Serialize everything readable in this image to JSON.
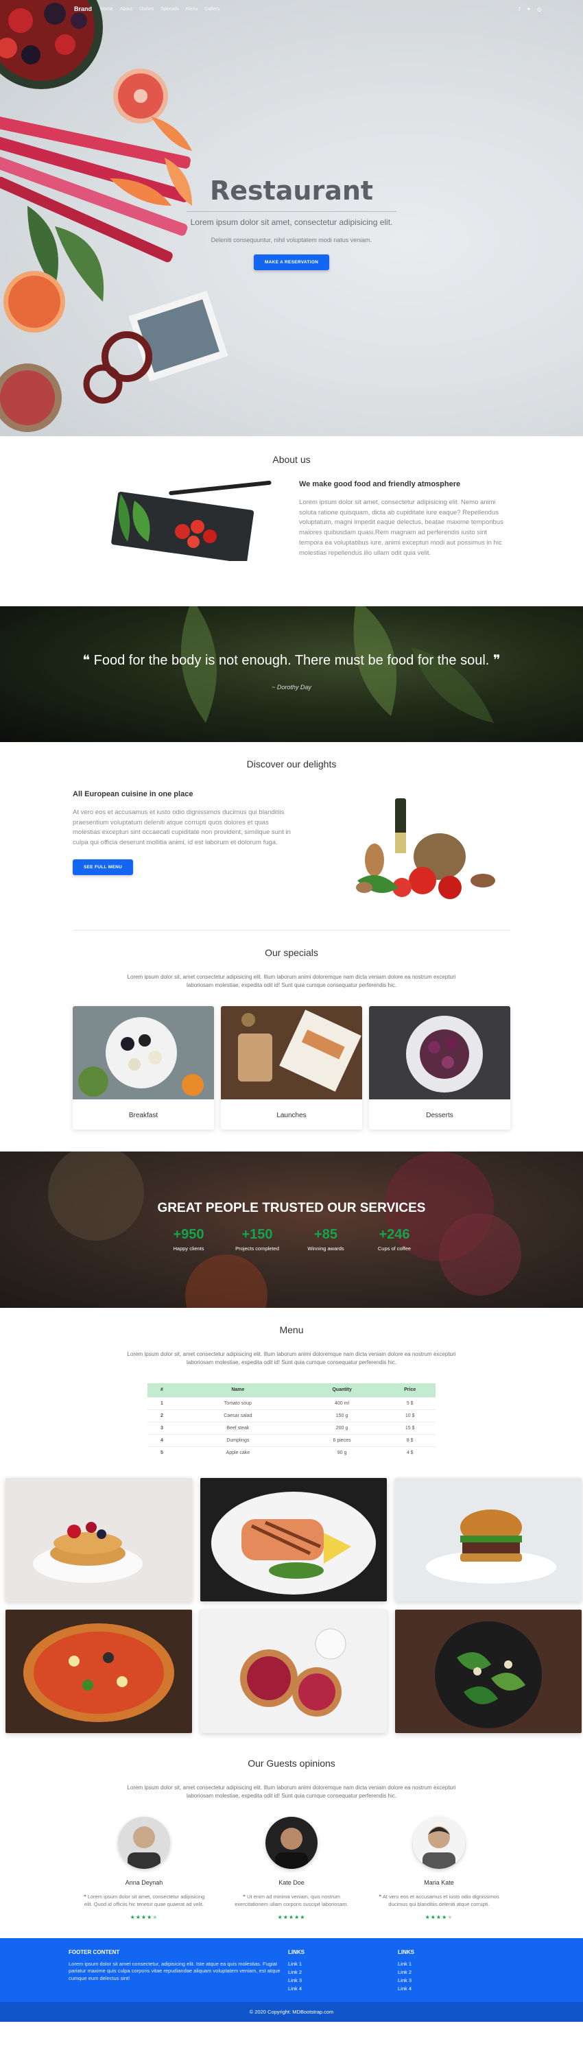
{
  "nav": {
    "brand": "Brand",
    "links": [
      "Home",
      "About",
      "Dishes",
      "Specials",
      "Menu",
      "Gallery"
    ],
    "social_icons": [
      "facebook-icon",
      "twitter-icon",
      "instagram-icon"
    ]
  },
  "hero": {
    "title": "Restaurant",
    "subtitle": "Lorem ipsum dolor sit amet, consectetur adipisicing elit.",
    "small": "Deleniti consequuntur, nihil voluptatem modi natus veniam.",
    "button": "Make a reservation"
  },
  "about": {
    "title": "About us",
    "heading": "We make good food and friendly atmosphere",
    "text": "Lorem ipsum dolor sit amet, consectetur adipisicing elit. Nemo animi soluta ratione quisquam, dicta ab cupiditate iure eaque? Repellendus voluptatum, magni impedit eaque delectus, beatae maxime temporibus maiores quibusdam quasi.Rem magnam ad perferendis iusto sint tempora ea voluptatibus iure, animi excepturi modi aut possimus in hic molestias repellendus illo ullam odit quia velit."
  },
  "quote": {
    "text": "Food for the body is not enough. There must be food for the soul.",
    "author": "~ Dorothy Day"
  },
  "discover": {
    "title": "Discover our delights",
    "heading": "All European cuisine in one place",
    "text": "At vero eos et accusamus et iusto odio dignissimos ducimus qui blanditiis praesentium voluptatum deleniti atque corrupti quos dolores et quas molestias excepturi sint occaecati cupiditate non provident, similique sunt in culpa qui officia deserunt mollitia animi, id est laborum et dolorum fuga.",
    "button": "See full menu"
  },
  "specials": {
    "title": "Our specials",
    "lead": "Lorem ipsum dolor sit, amet consectetur adipisicing elit. Illum laborum animi doloremque nam dicta veniam dolore ea nostrum excepturi laboriosam molestiae, expedita odit id! Sunt quia cumque consequatur perferendis hic.",
    "cards": [
      {
        "title": "Breakfast"
      },
      {
        "title": "Launches"
      },
      {
        "title": "Desserts"
      }
    ]
  },
  "stats": {
    "title": "GREAT PEOPLE TRUSTED OUR SERVICES",
    "items": [
      {
        "value": "+950",
        "label": "Happy clients"
      },
      {
        "value": "+150",
        "label": "Projects completed"
      },
      {
        "value": "+85",
        "label": "Winning awards"
      },
      {
        "value": "+246",
        "label": "Cups of coffee"
      }
    ]
  },
  "menu": {
    "title": "Menu",
    "lead": "Lorem ipsum dolor sit, amet consectetur adipisicing elit. Illum laborum animi doloremque nam dicta veniam dolore ea nostrum excepturi laboriosam molestiae, expedita odit id! Sunt quia cumque consequatur perferendis hic.",
    "columns": [
      "#",
      "Name",
      "Quantity",
      "Price"
    ],
    "rows": [
      [
        "1",
        "Tomato soup",
        "400 ml",
        "5 $"
      ],
      [
        "2",
        "Caesar salad",
        "150 g",
        "10 $"
      ],
      [
        "3",
        "Beef steak",
        "200 g",
        "15 $"
      ],
      [
        "4",
        "Dumplings",
        "6 pieces",
        "8 $"
      ],
      [
        "5",
        "Apple cake",
        "90 g",
        "4 $"
      ]
    ]
  },
  "testimonials": {
    "title": "Our Guests opinions",
    "lead": "Lorem ipsum dolor sit, amet consectetur adipisicing elit. Illum laborum animi doloremque nam dicta veniam dolore ea nostrum excepturi laboriosam molestiae, expedita odit id! Sunt quia cumque consequatur perferendis hic.",
    "items": [
      {
        "name": "Anna Deynah",
        "text": "Lorem ipsum dolor sit amet, consectetur adipisicing elit. Quod id officiis hic tenetur quae quaerat ad velit.",
        "rating": 4.5
      },
      {
        "name": "Kate Doe",
        "text": "Ut enim ad minima veniam, quis nostrum exercitationem ullam corporis suscipit laboriosam.",
        "rating": 5
      },
      {
        "name": "Maria Kate",
        "text": "At vero eos et accusamus et iusto odio dignissimos ducimus qui blanditiis deleniti atque corrupti.",
        "rating": 4
      }
    ]
  },
  "footer": {
    "content_title": "FOOTER CONTENT",
    "content_text": "Lorem ipsum dolor sit amet consectetur, adipisicing elit. Iste atque ea quis molestias. Fugiat pariatur maxime quis culpa corporis vitae repudiandae aliquam voluptatem veniam, est atque cumque eum delectus sint!",
    "links_title_1": "LINKS",
    "links_1": [
      "Link 1",
      "Link 2",
      "Link 3",
      "Link 4"
    ],
    "links_title_2": "LINKS",
    "links_2": [
      "Link 1",
      "Link 2",
      "Link 3",
      "Link 4"
    ],
    "copyright": "© 2020 Copyright: MDBootstrap.com"
  },
  "colors": {
    "primary": "#1266f1",
    "success": "#14a44d",
    "table_header": "#c3ebd0"
  }
}
